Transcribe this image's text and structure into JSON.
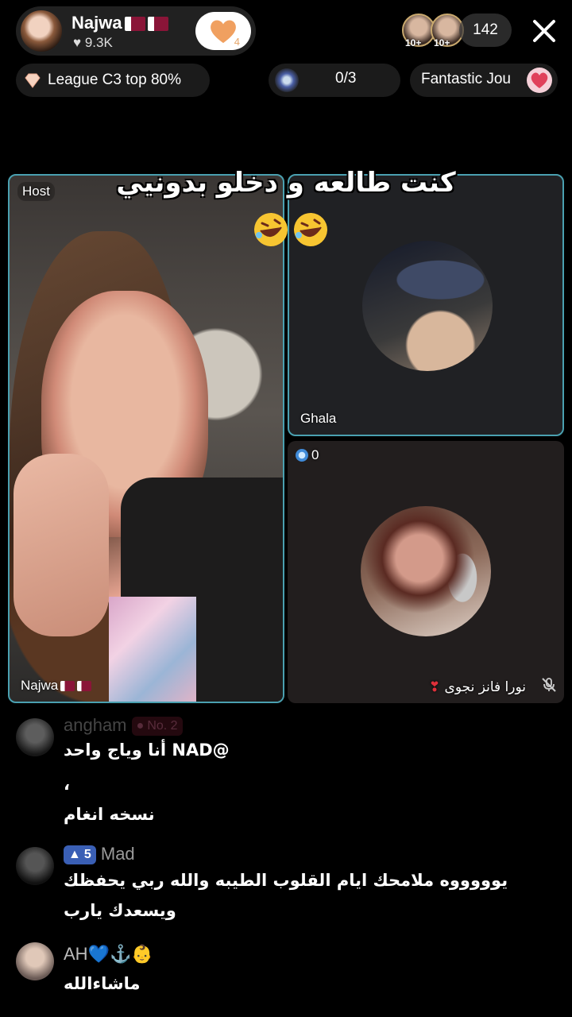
{
  "host": {
    "name": "Najwa",
    "likes": "9.3K",
    "follow_count": "4"
  },
  "viewers": {
    "avatar_badges": [
      "10+",
      "10+"
    ],
    "count": "142"
  },
  "league": {
    "label": "League C3 top 80%"
  },
  "gift_goal": {
    "progress": "0/3"
  },
  "promo": {
    "label": "Fantastic Jou"
  },
  "caption": {
    "text": "كنت طالعه و دخلو بدونيي"
  },
  "tiles": {
    "host_tag": "Host",
    "host_name": "Najwa",
    "guest1_name": "Ghala",
    "guest2_count": "0",
    "guest2_name": "نورا فانز نجوى"
  },
  "comments": [
    {
      "name": "angham",
      "badge": "No. 2",
      "text": "أنا وياج واحد NAD@"
    },
    {
      "name": "",
      "badge": "",
      "text": "،"
    },
    {
      "name": "",
      "badge": "",
      "text": "نسخه انغام"
    },
    {
      "name": "Mad",
      "badge": "5",
      "text": "يوووووه ملامحك ايام القلوب الطيبه والله ربي يحفظك",
      "text2": "ويسعدك يارب"
    },
    {
      "name": "AH💙⚓👶",
      "badge": "",
      "text": "ماشاءالله"
    }
  ],
  "colors": {
    "tile_border": "#4aa0b0",
    "badge_level": "#3a5fb5",
    "follow_heart": "#f0a060"
  }
}
